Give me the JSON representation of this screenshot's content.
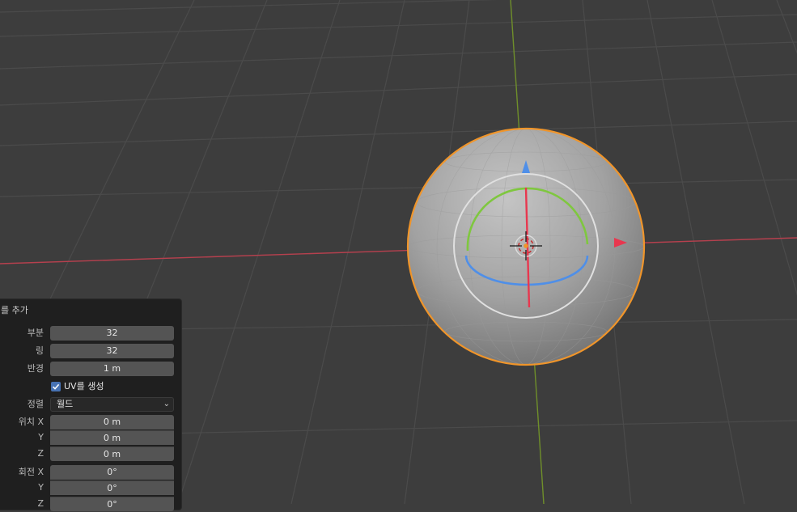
{
  "panel": {
    "title": "를 추가",
    "rows": {
      "segments": {
        "label": "부분",
        "value": "32"
      },
      "rings": {
        "label": "링",
        "value": "32"
      },
      "radius": {
        "label": "반경",
        "value": "1 m"
      },
      "uv": {
        "label": "UV를 생성",
        "checked": true
      },
      "align": {
        "label": "정렬",
        "value": "월드"
      },
      "loc_x": {
        "label": "위치 X",
        "value": "0 m"
      },
      "loc_y": {
        "label": "Y",
        "value": "0 m"
      },
      "loc_z": {
        "label": "Z",
        "value": "0 m"
      },
      "rot_x": {
        "label": "회전 X",
        "value": "0°"
      },
      "rot_y": {
        "label": "Y",
        "value": "0°"
      },
      "rot_z": {
        "label": "Z",
        "value": "0°"
      }
    }
  },
  "colors": {
    "viewport_bg": "#3d3d3d",
    "grid_line": "#4a4a4a",
    "x_axis": "#c0404e",
    "y_axis": "#7a9a2c",
    "selection_outline": "#f0952a",
    "gizmo_x": "#e8374f",
    "gizmo_y": "#7fc73f",
    "gizmo_z": "#4f8fe8",
    "checkbox": "#4772b3"
  },
  "icons": {
    "checkbox": "checkmark-icon",
    "dropdown": "chevron-down-icon",
    "cursor": "3d-cursor-icon"
  }
}
